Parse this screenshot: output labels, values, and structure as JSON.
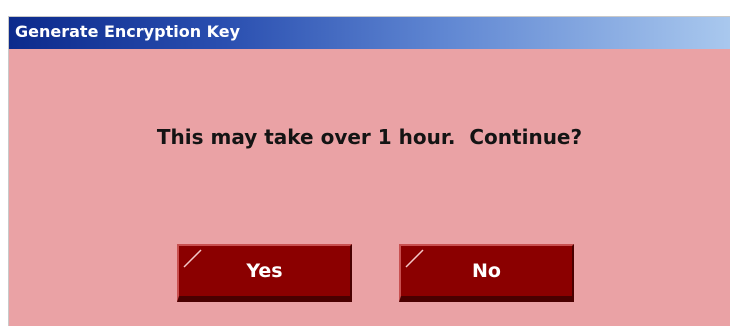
{
  "window": {
    "title": "Generate Encryption Key"
  },
  "dialog": {
    "message": "This may take over 1 hour.  Continue?",
    "yes_label": "Yes",
    "no_label": "No"
  },
  "colors": {
    "dialog_background": "#eaa2a5",
    "button_background": "#8b0000",
    "titlebar_start": "#0c2a8c",
    "titlebar_end": "#a9c8ee"
  }
}
